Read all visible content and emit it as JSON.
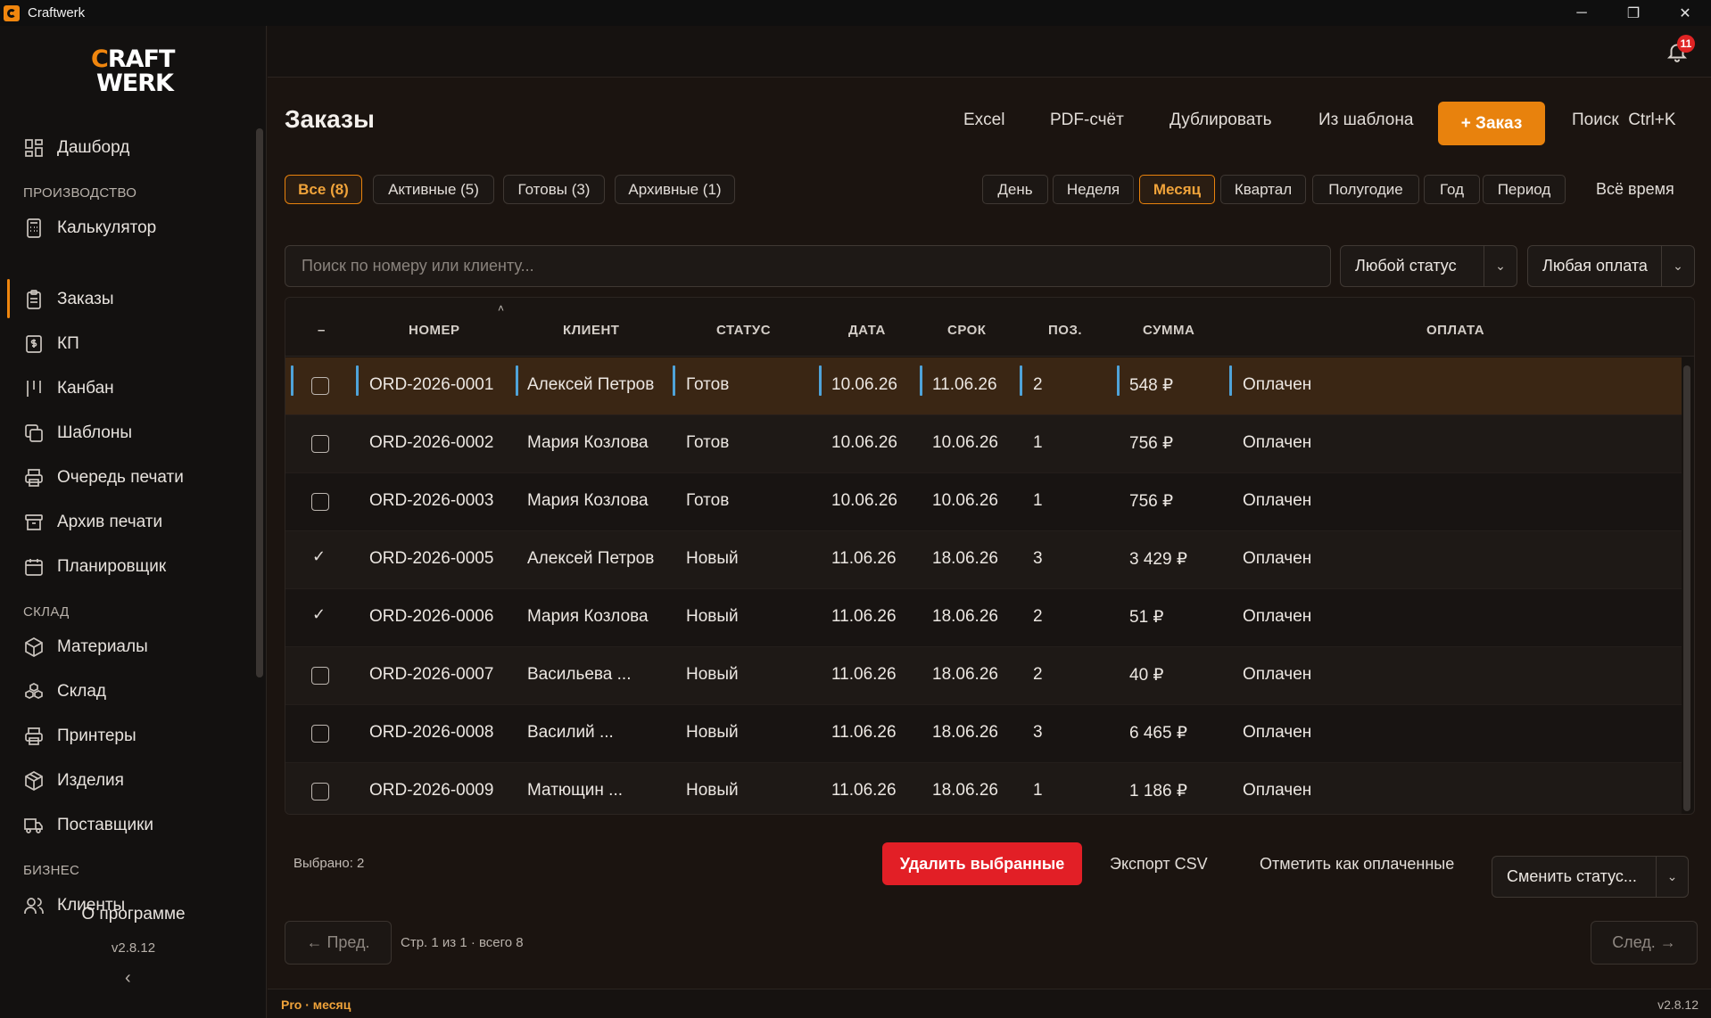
{
  "window": {
    "title": "Craftwerk",
    "minimize": "─",
    "maximize": "❐",
    "close": "✕"
  },
  "logo": {
    "line1_mark": "C",
    "line1_rest": "RAFT",
    "line2": "WERK"
  },
  "sidebar": {
    "dashboard": "Дашборд",
    "section_production": "ПРОИЗВОДСТВО",
    "calculator": "Калькулятор",
    "orders": "Заказы",
    "kp": "КП",
    "kanban": "Канбан",
    "templates": "Шаблоны",
    "print_queue": "Очередь печати",
    "print_archive": "Архив печати",
    "planner": "Планировщик",
    "section_warehouse": "СКЛАД",
    "materials": "Материалы",
    "warehouse": "Склад",
    "printers": "Принтеры",
    "products": "Изделия",
    "suppliers": "Поставщики",
    "section_business": "БИЗНЕС",
    "clients": "Клиенты",
    "about": "О программе",
    "version": "v2.8.12",
    "collapse": "‹"
  },
  "notifications": {
    "count": "11"
  },
  "page": {
    "title": "Заказы"
  },
  "toolbar": {
    "excel": "Excel",
    "pdf": "PDF-счёт",
    "duplicate": "Дублировать",
    "from_template": "Из шаблона",
    "add_order": "+ Заказ",
    "search": "Поиск  Ctrl+K"
  },
  "filters": {
    "all": "Все (8)",
    "active": "Активные (5)",
    "ready": "Готовы (3)",
    "archived": "Архивные (1)"
  },
  "periods": {
    "day": "День",
    "week": "Неделя",
    "month": "Месяц",
    "quarter": "Квартал",
    "half_year": "Полугодие",
    "year": "Год",
    "period": "Период",
    "all_time": "Всё время"
  },
  "search": {
    "placeholder": "Поиск по номеру или клиенту..."
  },
  "status_filter": {
    "value": "Любой статус"
  },
  "payment_filter": {
    "value": "Любая оплата"
  },
  "table": {
    "columns": {
      "select": "–",
      "number": "НОМЕР",
      "client": "КЛИЕНТ",
      "status": "СТАТУС",
      "date": "ДАТА",
      "due": "СРОК",
      "items": "ПОЗ.",
      "sum": "СУММА",
      "payment": "ОПЛАТА"
    },
    "sort_indicator": "˄",
    "rows": [
      {
        "checked": false,
        "number": "ORD-2026-0001",
        "client": "Алексей Петров",
        "status": "Готов",
        "date": "10.06.26",
        "due": "11.06.26",
        "items": "2",
        "sum": "548 ₽",
        "payment": "Оплачен"
      },
      {
        "checked": false,
        "number": "ORD-2026-0002",
        "client": "Мария Козлова",
        "status": "Готов",
        "date": "10.06.26",
        "due": "10.06.26",
        "items": "1",
        "sum": "756 ₽",
        "payment": "Оплачен"
      },
      {
        "checked": false,
        "number": "ORD-2026-0003",
        "client": "Мария Козлова",
        "status": "Готов",
        "date": "10.06.26",
        "due": "10.06.26",
        "items": "1",
        "sum": "756 ₽",
        "payment": "Оплачен"
      },
      {
        "checked": true,
        "number": "ORD-2026-0005",
        "client": "Алексей Петров",
        "status": "Новый",
        "date": "11.06.26",
        "due": "18.06.26",
        "items": "3",
        "sum": "3 429 ₽",
        "payment": "Оплачен"
      },
      {
        "checked": true,
        "number": "ORD-2026-0006",
        "client": "Мария Козлова",
        "status": "Новый",
        "date": "11.06.26",
        "due": "18.06.26",
        "items": "2",
        "sum": "51 ₽",
        "payment": "Оплачен"
      },
      {
        "checked": false,
        "number": "ORD-2026-0007",
        "client": "Васильева ...",
        "status": "Новый",
        "date": "11.06.26",
        "due": "18.06.26",
        "items": "2",
        "sum": "40 ₽",
        "payment": "Оплачен"
      },
      {
        "checked": false,
        "number": "ORD-2026-0008",
        "client": "Василий ...",
        "status": "Новый",
        "date": "11.06.26",
        "due": "18.06.26",
        "items": "3",
        "sum": "6 465 ₽",
        "payment": "Оплачен"
      },
      {
        "checked": false,
        "number": "ORD-2026-0009",
        "client": "Матющин ...",
        "status": "Новый",
        "date": "11.06.26",
        "due": "18.06.26",
        "items": "1",
        "sum": "1 186 ₽",
        "payment": "Оплачен"
      }
    ]
  },
  "bulk": {
    "selected": "Выбрано: 2",
    "delete": "Удалить выбранные",
    "export_csv": "Экспорт CSV",
    "mark_paid": "Отметить как оплаченные",
    "change_status": "Сменить статус..."
  },
  "pagination": {
    "prev": "← Пред.",
    "info": "Стр. 1 из 1 · всего 8",
    "next": "След. →"
  },
  "statusbar": {
    "plan": "Pro · месяц",
    "version": "v2.8.12"
  },
  "colors": {
    "accent": "#e8820d",
    "danger": "#e21f26",
    "highlight_row": "#3a2614",
    "marker": "#4fa3d9"
  }
}
